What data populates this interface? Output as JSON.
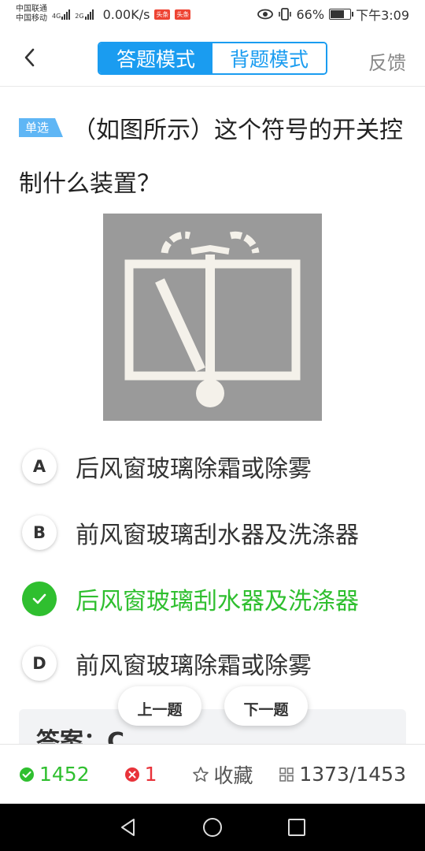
{
  "status_bar": {
    "carrier_1": "中国联通",
    "carrier_2": "中国移动",
    "net_1": "4G",
    "net_2": "2G",
    "speed": "0.00K/s",
    "badge_1": "头条",
    "badge_2": "头条",
    "battery": "66%",
    "battery_level": 0.66,
    "time": "下午3:09"
  },
  "header": {
    "mode_answer": "答题模式",
    "mode_memorize": "背题模式",
    "feedback": "反馈"
  },
  "question": {
    "type_tag": "单选",
    "text": "（如图所示）这个符号的开关控制什么装置？"
  },
  "options": [
    {
      "letter": "A",
      "text": "后风窗玻璃除霜或除雾",
      "state": "normal"
    },
    {
      "letter": "B",
      "text": "前风窗玻璃刮水器及洗涤器",
      "state": "normal"
    },
    {
      "letter": "C",
      "text": "后风窗玻璃刮水器及洗涤器",
      "state": "correct"
    },
    {
      "letter": "D",
      "text": "前风窗玻璃除霜或除雾",
      "state": "normal"
    }
  ],
  "nav_buttons": {
    "prev": "上一题",
    "next": "下一题"
  },
  "answer": {
    "label": "答案：C"
  },
  "bottom_bar": {
    "correct_count": "1452",
    "wrong_count": "1",
    "favorite": "收藏",
    "progress": "1373/1453"
  },
  "colors": {
    "accent": "#1a9cf0",
    "correct": "#2fbf2f",
    "wrong": "#e8333a"
  }
}
